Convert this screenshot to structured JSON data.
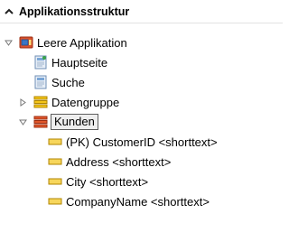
{
  "panel": {
    "title": "Applikationsstruktur",
    "collapse_icon": "chevron-up-icon"
  },
  "tree": {
    "app": {
      "label": "Leere Applikation",
      "icon": "application-icon",
      "expanded": true
    },
    "pages": [
      {
        "label": "Hauptseite",
        "icon": "page-icon"
      },
      {
        "label": "Suche",
        "icon": "page-icon"
      }
    ],
    "group": {
      "label": "Datengruppe",
      "icon": "data-group-icon",
      "expanded": false
    },
    "table": {
      "label": "Kunden",
      "icon": "table-icon",
      "expanded": true,
      "selected": true
    },
    "fields": [
      {
        "label": "(PK) CustomerID <shorttext>",
        "icon": "field-icon"
      },
      {
        "label": "Address <shorttext>",
        "icon": "field-icon"
      },
      {
        "label": "City <shorttext>",
        "icon": "field-icon"
      },
      {
        "label": "CompanyName <shorttext>",
        "icon": "field-icon"
      }
    ]
  },
  "colors": {
    "field_icon": "#f2c94c",
    "group_icon": "#e8b400",
    "table_icon": "#e2572a",
    "app_icon_red": "#d9532f",
    "app_icon_blue": "#3b76c4",
    "selection_border": "#5e5e5e"
  }
}
